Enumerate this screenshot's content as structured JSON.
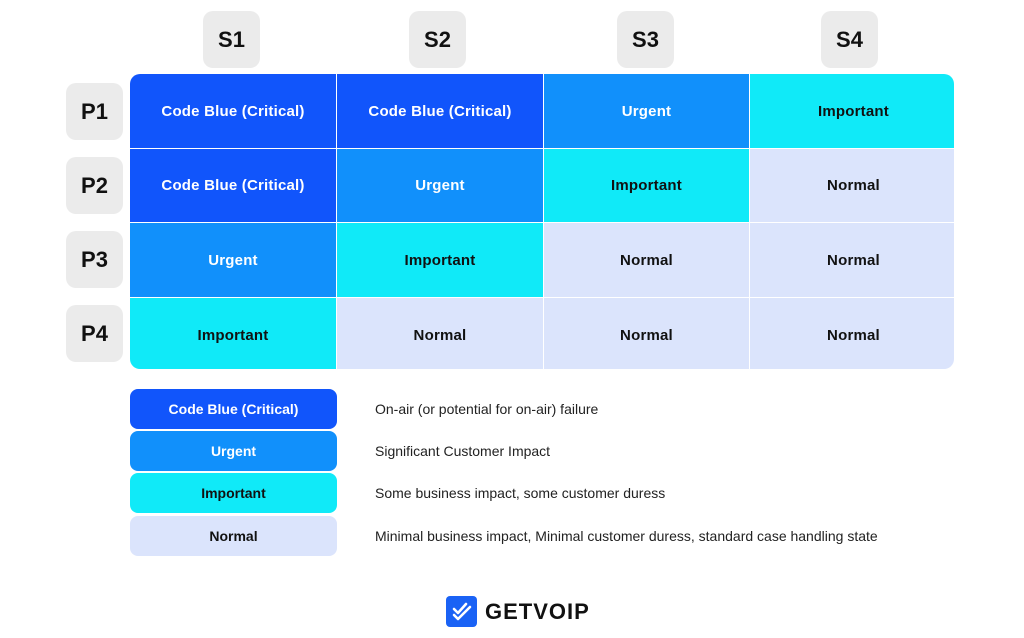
{
  "columns": [
    "S1",
    "S2",
    "S3",
    "S4"
  ],
  "rows": [
    "P1",
    "P2",
    "P3",
    "P4"
  ],
  "levels": {
    "critical": {
      "label": "Code Blue (Critical)",
      "color": "#1155fb",
      "description": "On-air (or potential for on-air) failure"
    },
    "urgent": {
      "label": "Urgent",
      "color": "#1190fb",
      "description": "Significant Customer Impact"
    },
    "important": {
      "label": "Important",
      "color": "#10eaf8",
      "description": "Some business impact, some customer duress"
    },
    "normal": {
      "label": "Normal",
      "color": "#dbe4fc",
      "description": "Minimal business impact, Minimal customer duress, standard case handling state"
    }
  },
  "matrix": [
    [
      "critical",
      "critical",
      "urgent",
      "important"
    ],
    [
      "critical",
      "urgent",
      "important",
      "normal"
    ],
    [
      "urgent",
      "important",
      "normal",
      "normal"
    ],
    [
      "important",
      "normal",
      "normal",
      "normal"
    ]
  ],
  "legend": [
    {
      "key": "critical",
      "label": "Code Blue (Critical)",
      "description": "On-air (or potential for on-air) failure"
    },
    {
      "key": "urgent",
      "label": "Urgent",
      "description": "Significant Customer Impact"
    },
    {
      "key": "important",
      "label": "Important",
      "description": "Some business impact, some customer duress"
    },
    {
      "key": "normal",
      "label": "Normal",
      "description": "Minimal business impact, Minimal customer duress, standard case handling state"
    }
  ],
  "brand": {
    "name": "GETVOIP",
    "icon": "double-check-icon",
    "color": "#1a62f5"
  }
}
